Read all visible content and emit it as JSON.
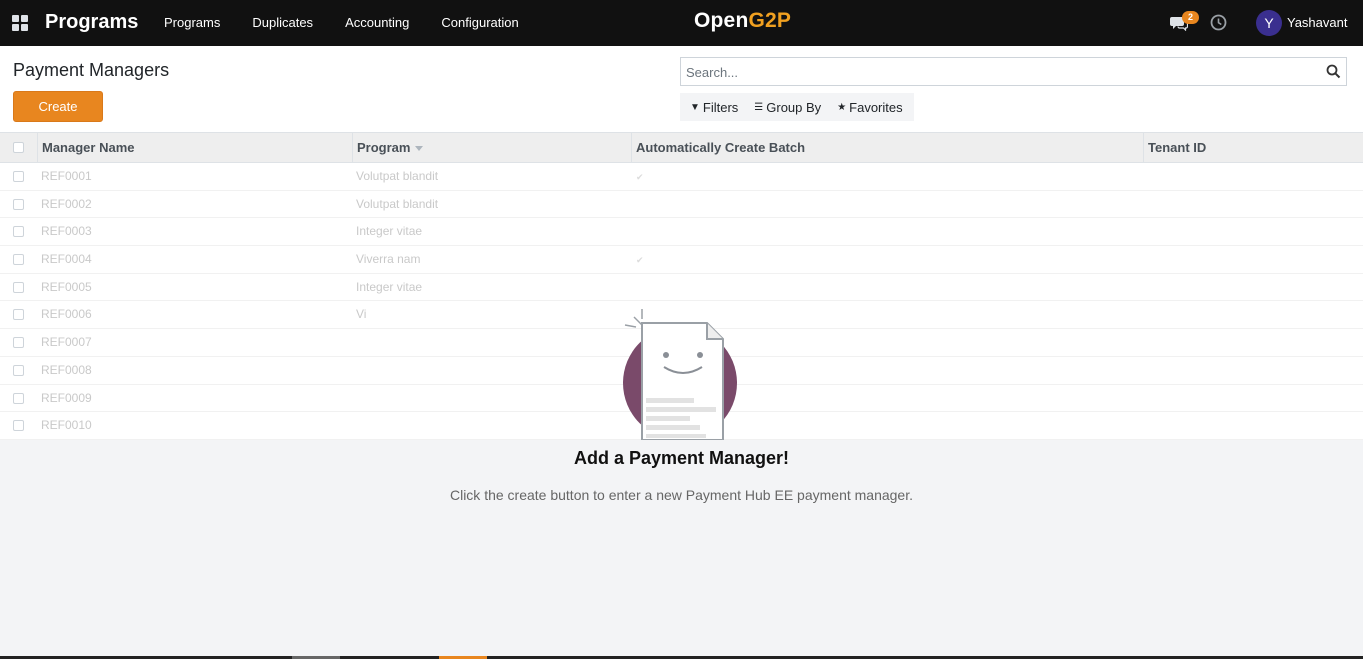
{
  "navbar": {
    "app_title": "Programs",
    "menu": [
      {
        "label": "Programs"
      },
      {
        "label": "Duplicates"
      },
      {
        "label": "Accounting"
      },
      {
        "label": "Configuration"
      }
    ],
    "logo_part1": "Open",
    "logo_part2": "G2P",
    "messages_count": "2",
    "user_initial": "Y",
    "user_name": "Yashavant"
  },
  "control_panel": {
    "title": "Payment Managers",
    "create_label": "Create",
    "search_placeholder": "Search...",
    "filters_label": "Filters",
    "group_by_label": "Group By",
    "favorites_label": "Favorites"
  },
  "table": {
    "columns": [
      {
        "label": "Manager Name"
      },
      {
        "label": "Program"
      },
      {
        "label": "Automatically Create Batch"
      },
      {
        "label": "Tenant ID"
      }
    ],
    "rows": [
      {
        "name": "REF0001",
        "program": "Volutpat blandit",
        "auto": "✔"
      },
      {
        "name": "REF0002",
        "program": "Volutpat blandit",
        "auto": ""
      },
      {
        "name": "REF0003",
        "program": "Integer vitae",
        "auto": ""
      },
      {
        "name": "REF0004",
        "program": "Viverra nam",
        "auto": "✔"
      },
      {
        "name": "REF0005",
        "program": "Integer vitae",
        "auto": ""
      },
      {
        "name": "REF0006",
        "program": "Vi",
        "auto": ""
      },
      {
        "name": "REF0007",
        "program": "",
        "auto": ""
      },
      {
        "name": "REF0008",
        "program": "",
        "auto": ""
      },
      {
        "name": "REF0009",
        "program": "",
        "auto": ""
      },
      {
        "name": "REF0010",
        "program": "",
        "auto": ""
      }
    ]
  },
  "helper": {
    "title": "Add a Payment Manager!",
    "text": "Click the create button to enter a new Payment Hub EE payment manager."
  },
  "colors": {
    "navbar": "#111111",
    "accent": "#e8861f",
    "avatar": "#3a2f8f"
  }
}
